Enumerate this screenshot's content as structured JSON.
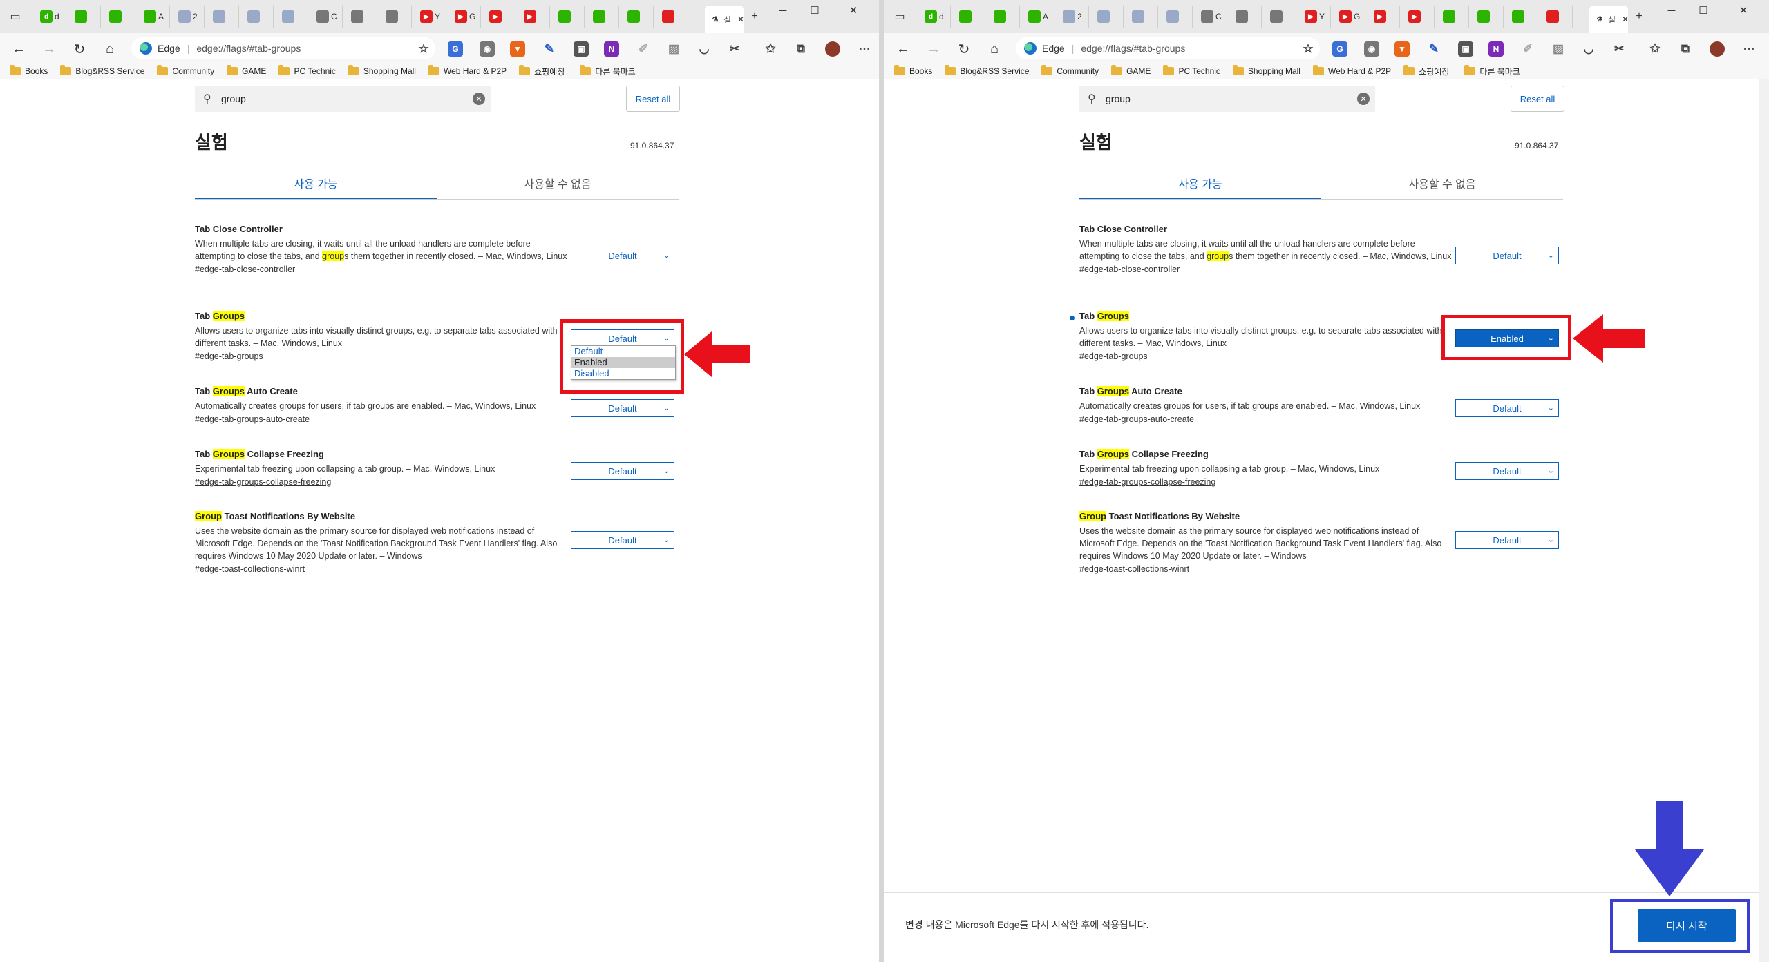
{
  "window": {
    "tab_icons": [
      {
        "label": "d",
        "color": "#2db400",
        "text": "d"
      },
      {
        "label": "",
        "color": "#2db400",
        "text": ""
      },
      {
        "label": "",
        "color": "#2db400",
        "text": ""
      },
      {
        "label": "A",
        "color": "#2db400",
        "text": ""
      },
      {
        "label": "2",
        "color": "#9aa9c7",
        "text": ""
      },
      {
        "label": "",
        "color": "#9aa9c7",
        "text": ""
      },
      {
        "label": "",
        "color": "#9aa9c7",
        "text": ""
      },
      {
        "label": "",
        "color": "#9aa9c7",
        "text": ""
      },
      {
        "label": "C",
        "color": "#777777",
        "text": ""
      },
      {
        "label": "",
        "color": "#777777",
        "text": ""
      },
      {
        "label": "",
        "color": "#777777",
        "text": ""
      },
      {
        "label": "Y",
        "color": "#e02020",
        "text": "▶"
      },
      {
        "label": "G",
        "color": "#e02020",
        "text": "▶"
      },
      {
        "label": "",
        "color": "#e02020",
        "text": "▶"
      },
      {
        "label": "",
        "color": "#e02020",
        "text": "▶"
      },
      {
        "label": "",
        "color": "#2db400",
        "text": ""
      },
      {
        "label": "",
        "color": "#2db400",
        "text": ""
      },
      {
        "label": "",
        "color": "#2db400",
        "text": ""
      },
      {
        "label": "",
        "color": "#e02020",
        "text": ""
      }
    ],
    "active_tab_label": "실",
    "new_tab_label": "+"
  },
  "toolbar": {
    "scheme": "Edge",
    "url": "edge://flags/#tab-groups"
  },
  "bookmarks": [
    "Books",
    "Blog&RSS Service",
    "Community",
    "GAME",
    "PC Technic",
    "Shopping Mall",
    "Web Hard & P2P",
    "쇼핑예정",
    "다른 북마크"
  ],
  "page": {
    "search_value": "group",
    "reset_all": "Reset all",
    "title": "실험",
    "version": "91.0.864.37",
    "tabs": [
      "사용 가능",
      "사용할 수 없음"
    ],
    "flags": [
      {
        "name_parts": [
          "Tab Close Controller",
          "",
          ""
        ],
        "desc_parts": [
          "When multiple tabs are closing, it waits until all the unload handlers are complete before attempting to close the tabs, and ",
          "group",
          "s them together in recently closed. – Mac, Windows, Linux"
        ],
        "link": "#edge-tab-close-controller",
        "value": "Default"
      },
      {
        "name_parts": [
          "Tab ",
          "Groups",
          ""
        ],
        "desc_parts": [
          "Allows users to organize tabs into visually distinct groups, e.g. to separate tabs associated with different tasks. – Mac, Windows, Linux",
          "",
          ""
        ],
        "link": "#edge-tab-groups",
        "value": "Default"
      },
      {
        "name_parts": [
          "Tab ",
          "Groups",
          " Auto Create"
        ],
        "desc_parts": [
          "Automatically creates groups for users, if tab groups are enabled. – Mac, Windows, Linux",
          "",
          ""
        ],
        "link": "#edge-tab-groups-auto-create",
        "value": "Default"
      },
      {
        "name_parts": [
          "Tab ",
          "Groups",
          " Collapse Freezing"
        ],
        "desc_parts": [
          "Experimental tab freezing upon collapsing a tab group. – Mac, Windows, Linux",
          "",
          ""
        ],
        "link": "#edge-tab-groups-collapse-freezing",
        "value": "Default"
      },
      {
        "name_parts": [
          "",
          "Group",
          " Toast Notifications By Website"
        ],
        "desc_parts": [
          "Uses the website domain as the primary source for displayed web notifications instead of Microsoft Edge. Depends on the 'Toast Notification Background Task Event Handlers' flag. Also requires Windows 10 May 2020 Update or later. – Windows",
          "",
          ""
        ],
        "link": "#edge-toast-collections-winrt",
        "value": "Default"
      }
    ],
    "dropdown_options": [
      "Default",
      "Enabled",
      "Disabled"
    ],
    "dropdown_hover": "Enabled"
  },
  "right_pane": {
    "tab_groups_value": "Enabled",
    "restart_message": "변경 내용은 Microsoft Edge를 다시 시작한 후에 적용됩니다.",
    "restart_button": "다시 시작"
  },
  "colors": {
    "accent": "#0b63c1",
    "highlight": "#ffff00",
    "annotation_red": "#e8101a",
    "annotation_blue": "#3a3fcf"
  }
}
